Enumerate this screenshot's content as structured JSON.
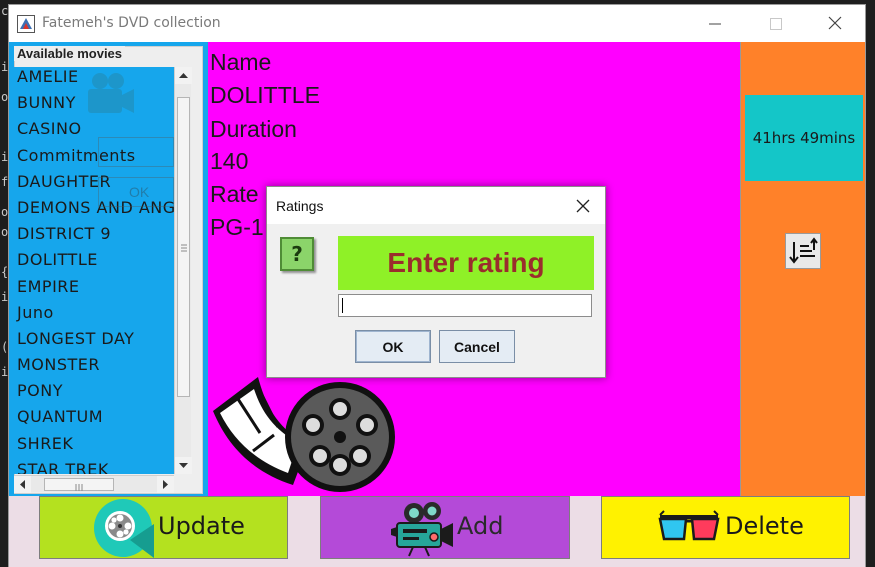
{
  "window": {
    "title": "Fatemeh's DVD collection"
  },
  "movies": {
    "legend": "Available movies",
    "items": [
      "AMELIE",
      "BUNNY",
      "CASINO",
      "Commitments",
      "DAUGHTER",
      "DEMONS AND ANGELS",
      "DISTRICT 9",
      "DOLITTLE",
      "EMPIRE",
      "Juno",
      "LONGEST DAY",
      "MONSTER",
      "PONY",
      "QUANTUM",
      "SHREK",
      "STAR TREK"
    ]
  },
  "details": {
    "name_label": "Name",
    "name_value": "DOLITTLE",
    "duration_label": "Duration",
    "duration_value": "140",
    "rate_label": "Rate",
    "rate_value": "PG-1"
  },
  "side": {
    "total_duration": "41hrs 49mins"
  },
  "buttons": {
    "update": "Update",
    "add": "Add",
    "delete": "Delete"
  },
  "dialog": {
    "title": "Ratings",
    "prompt": "Enter rating",
    "input_value": "",
    "ok": "OK",
    "cancel": "Cancel"
  },
  "colors": {
    "movies_bg": "#16a6ec",
    "details_bg": "#ff00ff",
    "side_bg": "#ff8129",
    "total_bg": "#14c6c8",
    "update_bg": "#b4e11f",
    "add_bg": "#b44ad8",
    "delete_bg": "#fff200",
    "prompt_bg": "#8ff127",
    "prompt_text": "#9a2d2d"
  }
}
